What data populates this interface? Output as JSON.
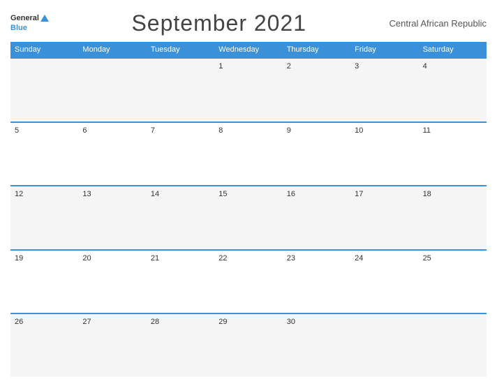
{
  "header": {
    "logo_general": "General",
    "logo_blue": "Blue",
    "title": "September 2021",
    "country": "Central African Republic"
  },
  "days_of_week": [
    "Sunday",
    "Monday",
    "Tuesday",
    "Wednesday",
    "Thursday",
    "Friday",
    "Saturday"
  ],
  "weeks": [
    [
      {
        "day": "",
        "empty": true
      },
      {
        "day": "",
        "empty": true
      },
      {
        "day": "",
        "empty": true
      },
      {
        "day": "1",
        "empty": false
      },
      {
        "day": "2",
        "empty": false
      },
      {
        "day": "3",
        "empty": false
      },
      {
        "day": "4",
        "empty": false
      }
    ],
    [
      {
        "day": "5",
        "empty": false
      },
      {
        "day": "6",
        "empty": false
      },
      {
        "day": "7",
        "empty": false
      },
      {
        "day": "8",
        "empty": false
      },
      {
        "day": "9",
        "empty": false
      },
      {
        "day": "10",
        "empty": false
      },
      {
        "day": "11",
        "empty": false
      }
    ],
    [
      {
        "day": "12",
        "empty": false
      },
      {
        "day": "13",
        "empty": false
      },
      {
        "day": "14",
        "empty": false
      },
      {
        "day": "15",
        "empty": false
      },
      {
        "day": "16",
        "empty": false
      },
      {
        "day": "17",
        "empty": false
      },
      {
        "day": "18",
        "empty": false
      }
    ],
    [
      {
        "day": "19",
        "empty": false
      },
      {
        "day": "20",
        "empty": false
      },
      {
        "day": "21",
        "empty": false
      },
      {
        "day": "22",
        "empty": false
      },
      {
        "day": "23",
        "empty": false
      },
      {
        "day": "24",
        "empty": false
      },
      {
        "day": "25",
        "empty": false
      }
    ],
    [
      {
        "day": "26",
        "empty": false
      },
      {
        "day": "27",
        "empty": false
      },
      {
        "day": "28",
        "empty": false
      },
      {
        "day": "29",
        "empty": false
      },
      {
        "day": "30",
        "empty": false
      },
      {
        "day": "",
        "empty": true
      },
      {
        "day": "",
        "empty": true
      }
    ]
  ]
}
